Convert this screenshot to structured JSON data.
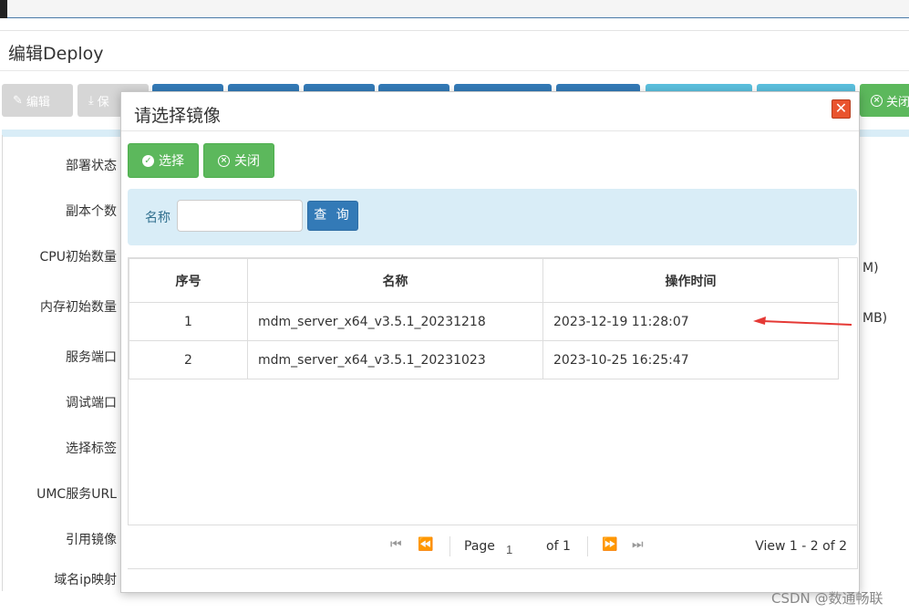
{
  "page": {
    "title": "编辑Deploy"
  },
  "toolbar": {
    "edit_label": "编辑",
    "save_label": "保",
    "close_label": "关闭"
  },
  "form": {
    "labels": [
      "部署状态",
      "副本个数",
      "CPU初始数量",
      "内存初始数量",
      "服务端口",
      "调试端口",
      "选择标签",
      "UMC服务URL",
      "引用镜像",
      "域名ip映射"
    ],
    "right_fragments": [
      "M)",
      "MB)"
    ]
  },
  "modal": {
    "title": "请选择镜像",
    "close_icon": "close-x-icon",
    "select_label": "选择",
    "close_label": "关闭",
    "search": {
      "label": "名称",
      "value": "",
      "button_label": "查 询"
    },
    "table": {
      "headers": [
        "序号",
        "名称",
        "操作时间"
      ],
      "rows": [
        {
          "idx": "1",
          "name": "mdm_server_x64_v3.5.1_20231218",
          "time": "2023-12-19 11:28:07"
        },
        {
          "idx": "2",
          "name": "mdm_server_x64_v3.5.1_20231023",
          "time": "2023-10-25 16:25:47"
        }
      ]
    },
    "pager": {
      "page_label": "Page",
      "page_value": "1",
      "of_label": "of 1",
      "view_label": "View 1 - 2 of 2"
    }
  },
  "annotation_arrow_color": "#e53935",
  "watermark": "CSDN @数通畅联"
}
